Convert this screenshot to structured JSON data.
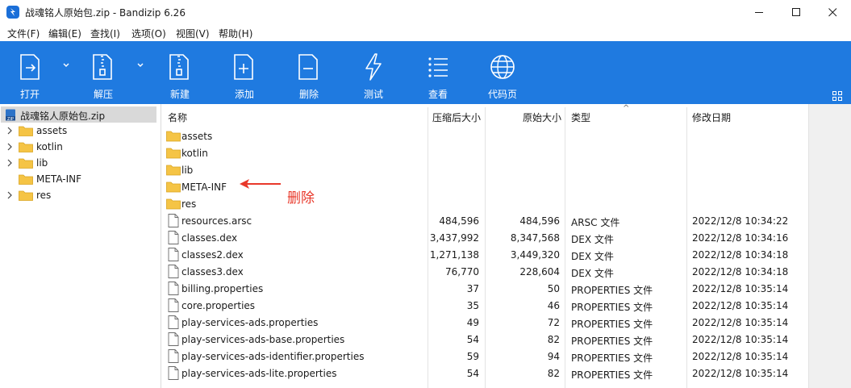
{
  "window": {
    "title": "战魂铭人原始包.zip - Bandizip 6.26"
  },
  "menu": [
    {
      "label": "文件(F)"
    },
    {
      "label": "编辑(E)"
    },
    {
      "label": "查找(I)"
    },
    {
      "label": "选项(O)"
    },
    {
      "label": "视图(V)"
    },
    {
      "label": "帮助(H)"
    }
  ],
  "toolbar": {
    "open": "打开",
    "extract": "解压",
    "new": "新建",
    "add": "添加",
    "delete": "删除",
    "test": "测试",
    "view": "查看",
    "codepage": "代码页"
  },
  "tree": {
    "root": "战魂铭人原始包.zip",
    "items": [
      {
        "label": "assets"
      },
      {
        "label": "kotlin"
      },
      {
        "label": "lib"
      },
      {
        "label": "META-INF"
      },
      {
        "label": "res"
      }
    ]
  },
  "columns": {
    "name": "名称",
    "compressed": "压缩后大小",
    "original": "原始大小",
    "type": "类型",
    "modified": "修改日期"
  },
  "rows": [
    {
      "name": "assets",
      "kind": "folder",
      "compressed": "",
      "original": "",
      "type": "",
      "modified": ""
    },
    {
      "name": "kotlin",
      "kind": "folder",
      "compressed": "",
      "original": "",
      "type": "",
      "modified": ""
    },
    {
      "name": "lib",
      "kind": "folder",
      "compressed": "",
      "original": "",
      "type": "",
      "modified": ""
    },
    {
      "name": "META-INF",
      "kind": "folder",
      "compressed": "",
      "original": "",
      "type": "",
      "modified": ""
    },
    {
      "name": "res",
      "kind": "folder",
      "compressed": "",
      "original": "",
      "type": "",
      "modified": ""
    },
    {
      "name": "resources.arsc",
      "kind": "file",
      "compressed": "484,596",
      "original": "484,596",
      "type": "ARSC 文件",
      "modified": "2022/12/8 10:34:22"
    },
    {
      "name": "classes.dex",
      "kind": "file",
      "compressed": "3,437,992",
      "original": "8,347,568",
      "type": "DEX 文件",
      "modified": "2022/12/8 10:34:16"
    },
    {
      "name": "classes2.dex",
      "kind": "file",
      "compressed": "1,271,138",
      "original": "3,449,320",
      "type": "DEX 文件",
      "modified": "2022/12/8 10:34:18"
    },
    {
      "name": "classes3.dex",
      "kind": "file",
      "compressed": "76,770",
      "original": "228,604",
      "type": "DEX 文件",
      "modified": "2022/12/8 10:34:18"
    },
    {
      "name": "billing.properties",
      "kind": "file",
      "compressed": "37",
      "original": "50",
      "type": "PROPERTIES 文件",
      "modified": "2022/12/8 10:35:14"
    },
    {
      "name": "core.properties",
      "kind": "file",
      "compressed": "35",
      "original": "46",
      "type": "PROPERTIES 文件",
      "modified": "2022/12/8 10:35:14"
    },
    {
      "name": "play-services-ads.properties",
      "kind": "file",
      "compressed": "49",
      "original": "72",
      "type": "PROPERTIES 文件",
      "modified": "2022/12/8 10:35:14"
    },
    {
      "name": "play-services-ads-base.properties",
      "kind": "file",
      "compressed": "54",
      "original": "82",
      "type": "PROPERTIES 文件",
      "modified": "2022/12/8 10:35:14"
    },
    {
      "name": "play-services-ads-identifier.properties",
      "kind": "file",
      "compressed": "59",
      "original": "94",
      "type": "PROPERTIES 文件",
      "modified": "2022/12/8 10:35:14"
    },
    {
      "name": "play-services-ads-lite.properties",
      "kind": "file",
      "compressed": "54",
      "original": "82",
      "type": "PROPERTIES 文件",
      "modified": "2022/12/8 10:35:14"
    }
  ],
  "annotation": {
    "text": "删除",
    "color": "#e8382a"
  },
  "colors": {
    "toolbar": "#1f7ae0",
    "folder": "#f5c445",
    "selection": "#d9d9d9"
  }
}
